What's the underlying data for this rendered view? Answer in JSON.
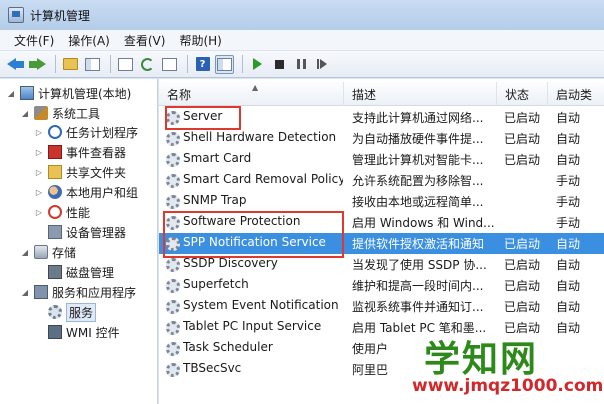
{
  "window": {
    "title": "计算机管理"
  },
  "menu": [
    "文件(F)",
    "操作(A)",
    "查看(V)",
    "帮助(H)"
  ],
  "toolbar": {
    "icons": [
      "back-arrow-icon",
      "forward-arrow-icon",
      "up-folder-icon",
      "console-tree-icon",
      "properties-icon",
      "refresh-icon",
      "export-icon",
      "help-icon",
      "show-hide-pane-icon",
      "start-icon",
      "stop-icon",
      "pause-icon",
      "restart-icon"
    ]
  },
  "tree": {
    "items": [
      {
        "label": "计算机管理(本地)",
        "icon": "computer-icon"
      },
      {
        "label": "系统工具",
        "icon": "tools-icon"
      },
      {
        "label": "任务计划程序",
        "icon": "clock-icon"
      },
      {
        "label": "事件查看器",
        "icon": "event-log-icon"
      },
      {
        "label": "共享文件夹",
        "icon": "shared-folder-icon"
      },
      {
        "label": "本地用户和组",
        "icon": "users-icon"
      },
      {
        "label": "性能",
        "icon": "performance-icon"
      },
      {
        "label": "设备管理器",
        "icon": "device-manager-icon"
      },
      {
        "label": "存储",
        "icon": "storage-icon"
      },
      {
        "label": "磁盘管理",
        "icon": "disk-icon"
      },
      {
        "label": "服务和应用程序",
        "icon": "services-apps-icon"
      },
      {
        "label": "服务",
        "icon": "gear-icon"
      },
      {
        "label": "WMI 控件",
        "icon": "wmi-icon"
      }
    ]
  },
  "list": {
    "columns": [
      "名称",
      "描述",
      "状态",
      "启动类"
    ],
    "rows": [
      {
        "name": "Server",
        "desc": "支持此计算机通过网络...",
        "status": "已启动",
        "startup": "自动"
      },
      {
        "name": "Shell Hardware Detection",
        "desc": "为自动播放硬件事件提...",
        "status": "已启动",
        "startup": "自动"
      },
      {
        "name": "Smart Card",
        "desc": "管理此计算机对智能卡...",
        "status": "已启动",
        "startup": "自动"
      },
      {
        "name": "Smart Card Removal Policy",
        "desc": "允许系统配置为移除智...",
        "status": "",
        "startup": "手动"
      },
      {
        "name": "SNMP Trap",
        "desc": "接收由本地或远程简单...",
        "status": "",
        "startup": "手动"
      },
      {
        "name": "Software Protection",
        "desc": "启用 Windows 和 Wind...",
        "status": "",
        "startup": "手动"
      },
      {
        "name": "SPP Notification Service",
        "desc": "提供软件授权激活和通知",
        "status": "已启动",
        "startup": "自动"
      },
      {
        "name": "SSDP Discovery",
        "desc": "当发现了使用 SSDP 协...",
        "status": "已启动",
        "startup": "自动"
      },
      {
        "name": "Superfetch",
        "desc": "维护和提高一段时间内...",
        "status": "已启动",
        "startup": "自动"
      },
      {
        "name": "System Event Notification ...",
        "desc": "监视系统事件并通知订...",
        "status": "已启动",
        "startup": "自动"
      },
      {
        "name": "Tablet PC Input Service",
        "desc": "启用 Tablet PC 笔和墨...",
        "status": "已启动",
        "startup": "自动"
      },
      {
        "name": "Task Scheduler",
        "desc": "使用户",
        "status": "",
        "startup": ""
      },
      {
        "name": "TBSecSvc",
        "desc": "阿里巴",
        "status": "",
        "startup": ""
      }
    ]
  },
  "watermark": {
    "logo": "学知网",
    "url": "www.jmqz1000.com"
  },
  "colors": {
    "selection": "#3b8fe0",
    "highlight_box": "#e0382f",
    "watermark_logo": "#2d8a1a",
    "watermark_url": "#d2282a"
  }
}
